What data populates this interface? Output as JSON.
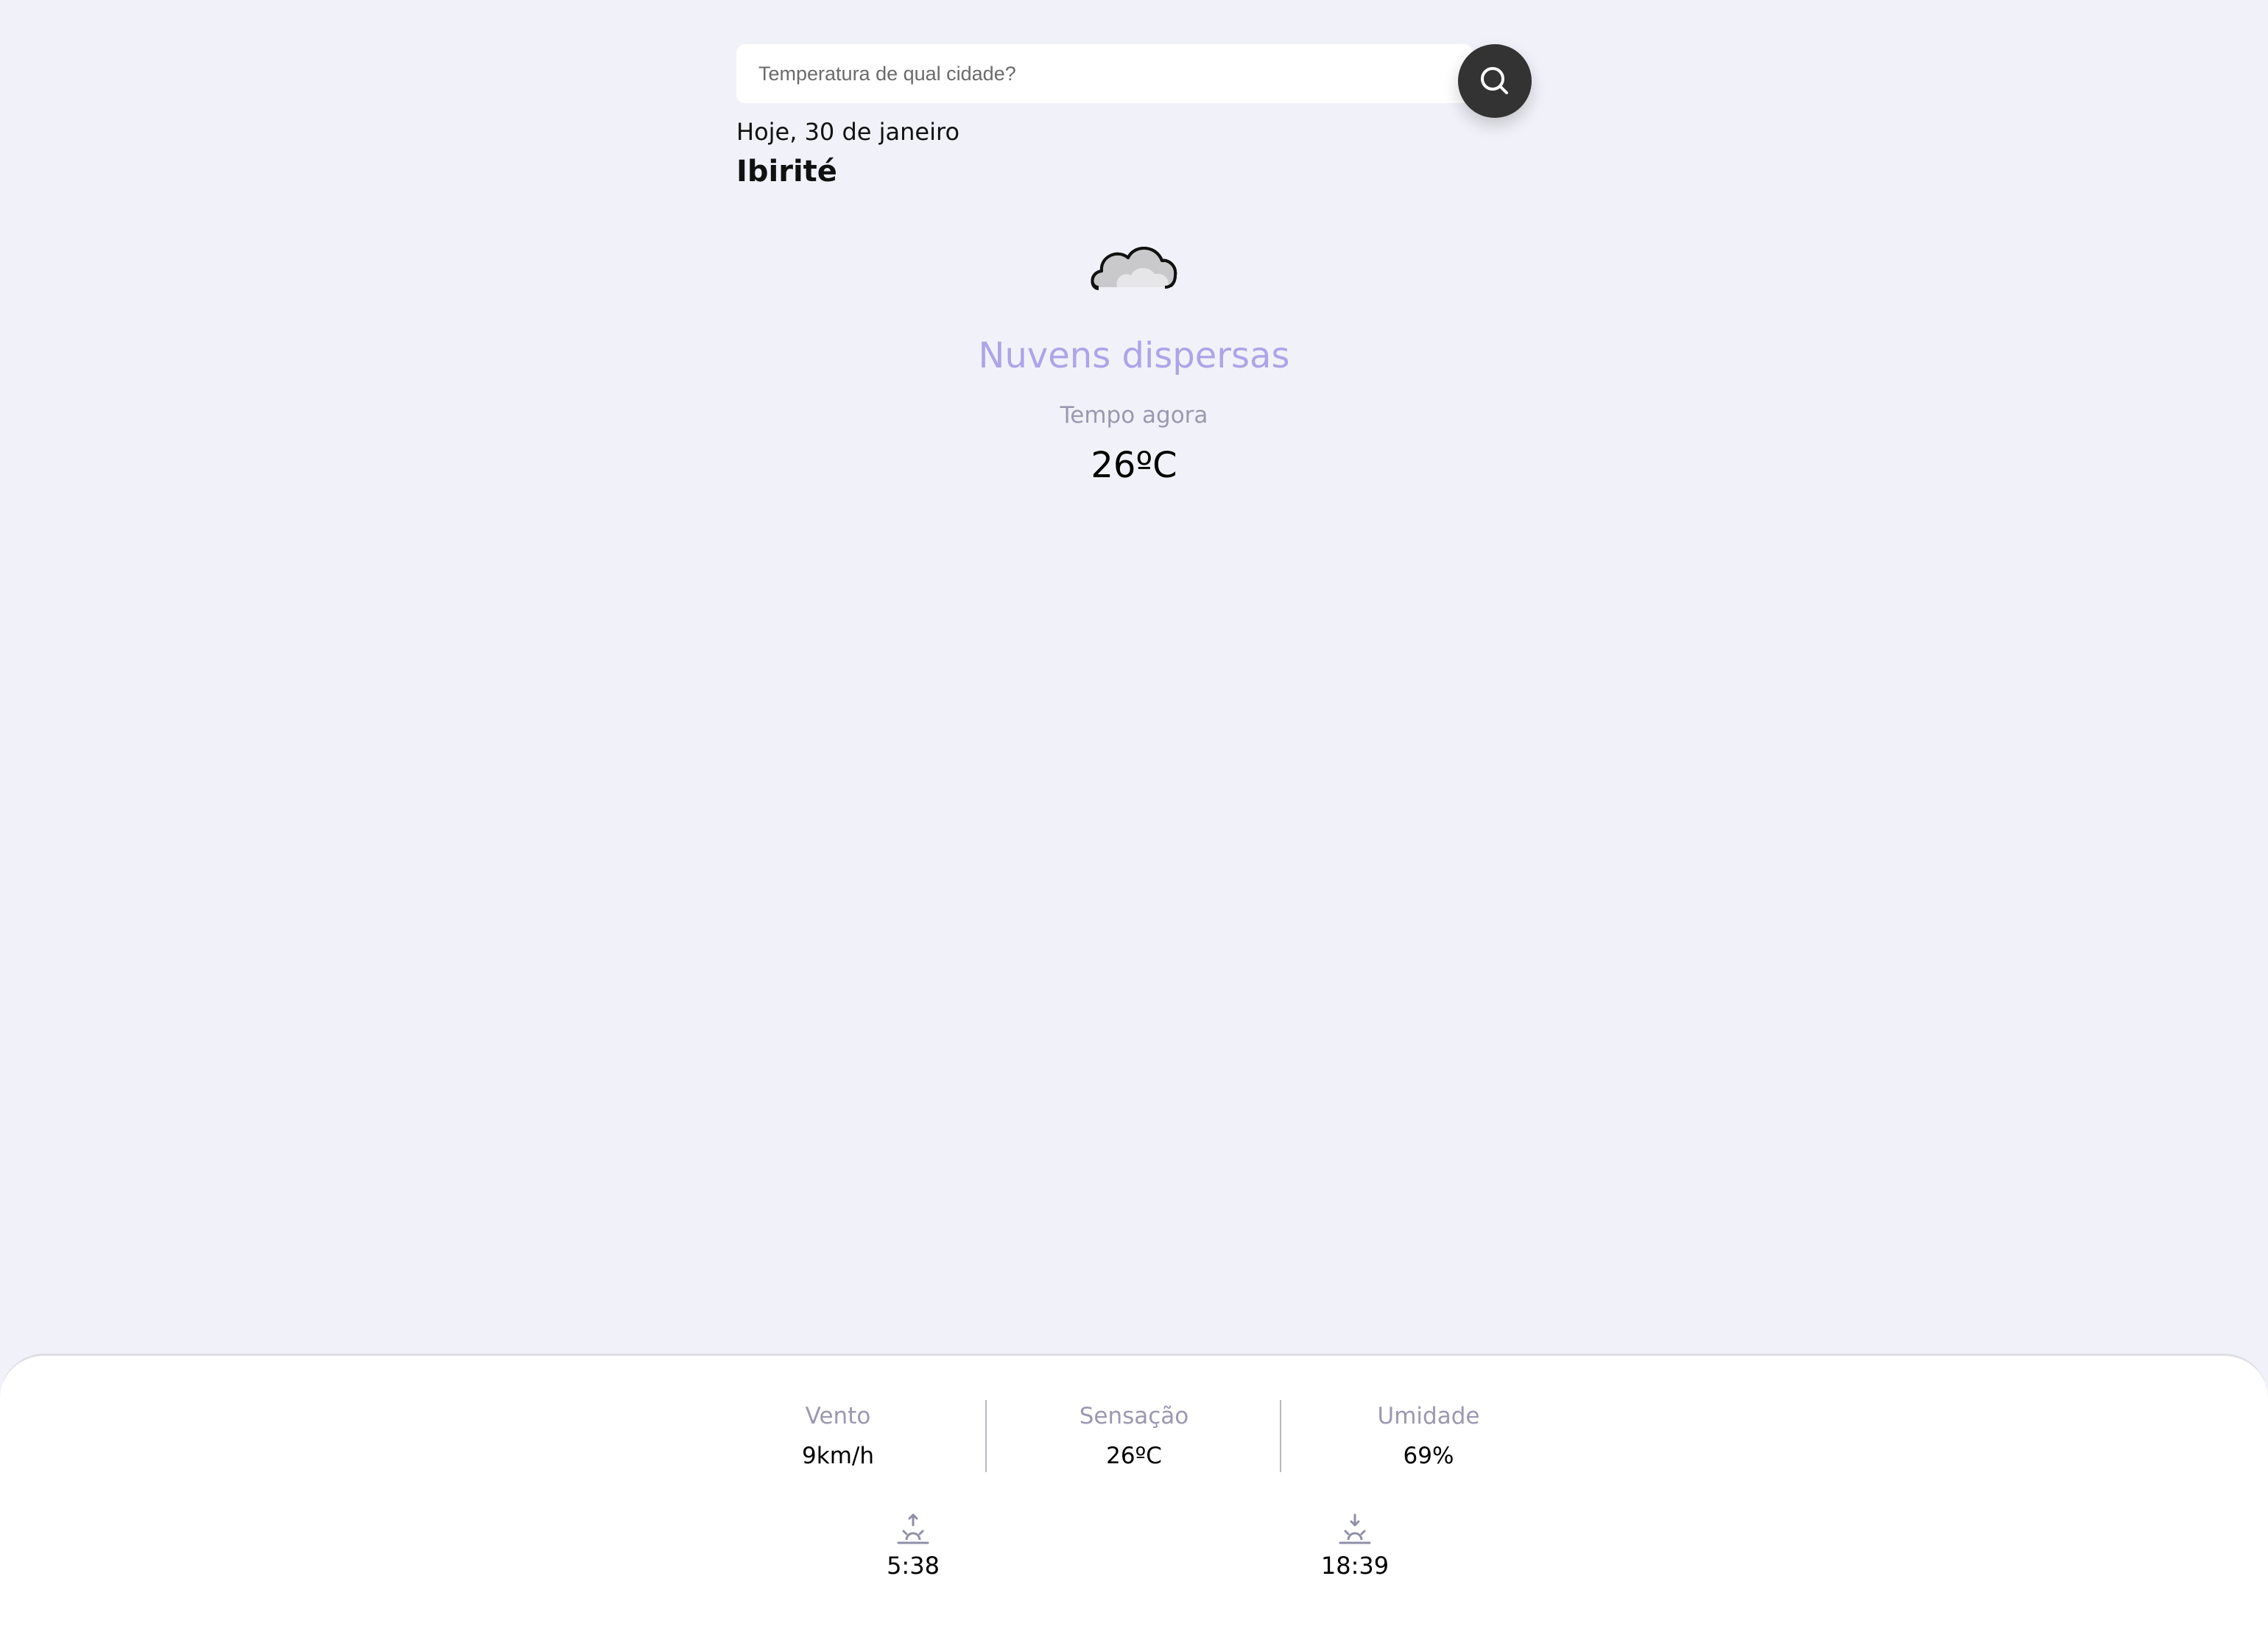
{
  "search": {
    "placeholder": "Temperatura de qual cidade?",
    "value": ""
  },
  "header": {
    "date": "Hoje, 30 de janeiro",
    "city": "Ibirité"
  },
  "current": {
    "icon": "cloud-icon",
    "condition": "Nuvens dispersas",
    "label": "Tempo agora",
    "temperature": "26ºC"
  },
  "details": {
    "wind": {
      "label": "Vento",
      "value": "9km/h"
    },
    "feels_like": {
      "label": "Sensação",
      "value": "26ºC"
    },
    "humidity": {
      "label": "Umidade",
      "value": "69%"
    }
  },
  "sun": {
    "sunrise": {
      "icon": "sunrise-icon",
      "time": "5:38"
    },
    "sunset": {
      "icon": "sunset-icon",
      "time": "18:39"
    }
  },
  "colors": {
    "background": "#f1f2f9",
    "accent": "#ada4e8",
    "muted": "#9b98b0",
    "button": "#333333"
  }
}
